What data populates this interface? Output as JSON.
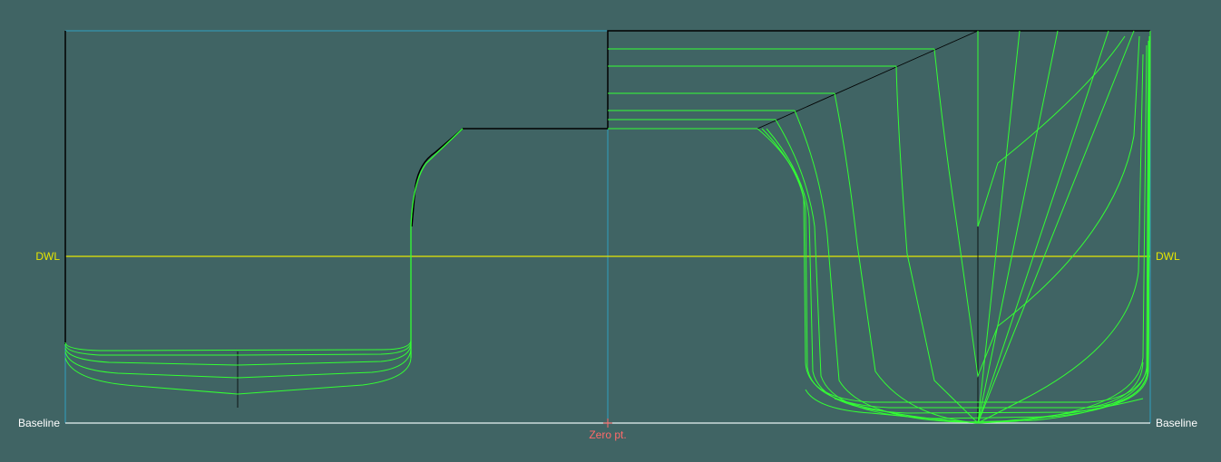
{
  "labels": {
    "dwl_left": "DWL",
    "dwl_right": "DWL",
    "baseline_left": "Baseline",
    "baseline_right": "Baseline",
    "zero_point": "Zero pt."
  },
  "colors": {
    "background": "#406464",
    "hull_lines": "#33ff33",
    "dwl": "#e6e600",
    "baseline": "#e8f4f4",
    "frame": "#2f9fc0",
    "outline": "#000000",
    "zero_point": "#ff6a6a"
  }
}
